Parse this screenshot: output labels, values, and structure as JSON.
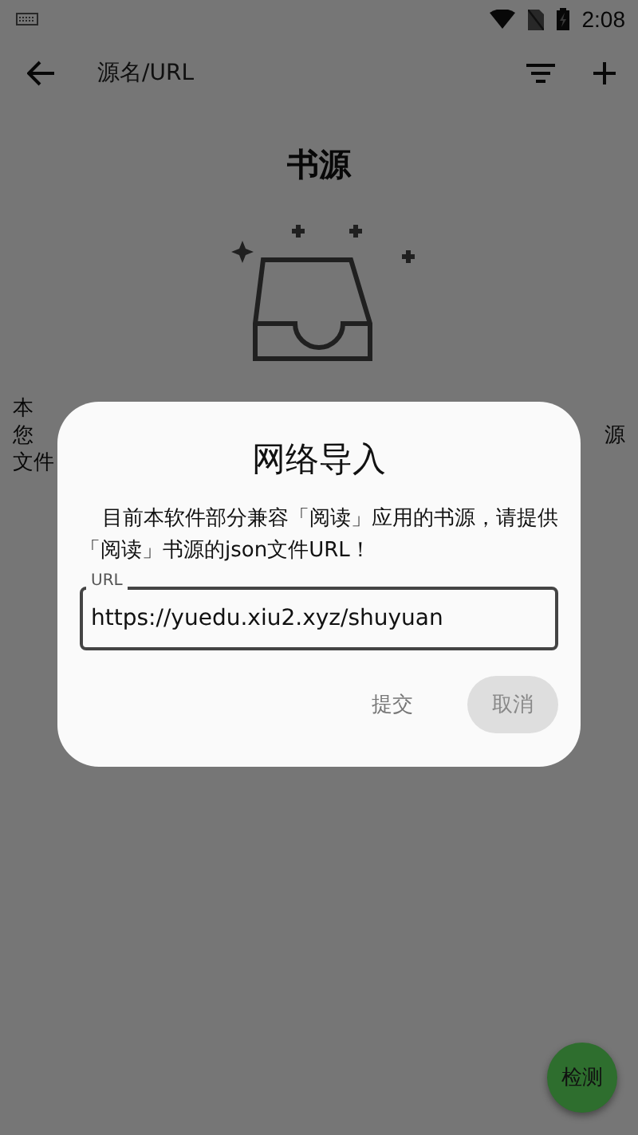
{
  "status_bar": {
    "time": "2:08"
  },
  "app_bar": {
    "search_placeholder": "源名/URL"
  },
  "page": {
    "title": "书源",
    "hidden_text": [
      {
        "left": "本"
      },
      {
        "left": "您",
        "right": "源"
      },
      {
        "left": "文件"
      }
    ]
  },
  "dialog": {
    "title": "网络导入",
    "message": "目前本软件部分兼容「阅读」应用的书源，请提供「阅读」书源的json文件URL！",
    "field": {
      "label": "URL",
      "value": "https://yuedu.xiu2.xyz/shuyuan"
    },
    "buttons": [
      {
        "label": "提交",
        "kind": "text"
      },
      {
        "label": "取消",
        "kind": "filled"
      }
    ]
  },
  "fab": {
    "label": "检测"
  }
}
